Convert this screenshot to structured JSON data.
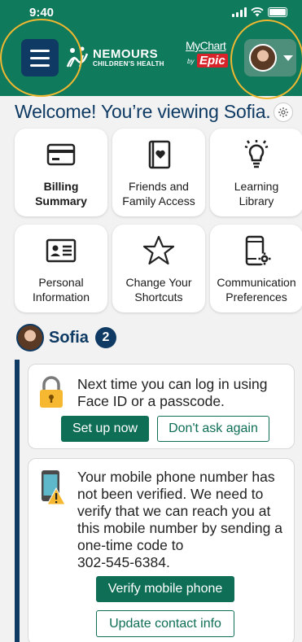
{
  "status_bar": {
    "time": "9:40"
  },
  "header": {
    "logo_name": "NEMOURS",
    "logo_sub": "CHILDREN'S HEALTH",
    "mychart_top": "MyChart",
    "mychart_by": "by",
    "mychart_epic": "Epic"
  },
  "welcome": {
    "text": "Welcome! You’re viewing Sofia."
  },
  "shortcuts": [
    {
      "line1": "Billing",
      "line2": "Summary",
      "icon": "credit-card-icon"
    },
    {
      "line1": "Friends and",
      "line2": "Family Access",
      "icon": "heart-book-icon"
    },
    {
      "line1": "Learning",
      "line2": "Library",
      "icon": "lightbulb-icon"
    },
    {
      "line1": "Personal",
      "line2": "Information",
      "icon": "id-card-icon"
    },
    {
      "line1": "Change Your",
      "line2": "Shortcuts",
      "icon": "star-icon"
    },
    {
      "line1": "Communication",
      "line2": "Preferences",
      "icon": "phone-settings-icon"
    }
  ],
  "patient": {
    "name": "Sofia",
    "count": "2"
  },
  "cards": {
    "login": {
      "line1": "Next time you can log in using",
      "line2": "Face ID or a passcode.",
      "primary_button": "Set up now",
      "secondary_button": "Don't ask again"
    },
    "mobile": {
      "lines": [
        "Your mobile phone number has",
        "not been verified. We need to",
        "verify that we can reach you at",
        "this mobile number by sending a",
        "one-time code to",
        "302-545-6384."
      ],
      "primary_button": "Verify mobile phone",
      "secondary_button": "Update contact info"
    }
  },
  "colors": {
    "header_green": "#0f7a5c",
    "navy": "#0e3a63",
    "button_green": "#0f6e56",
    "highlight": "#f0b731",
    "epic_red": "#d8232a"
  }
}
